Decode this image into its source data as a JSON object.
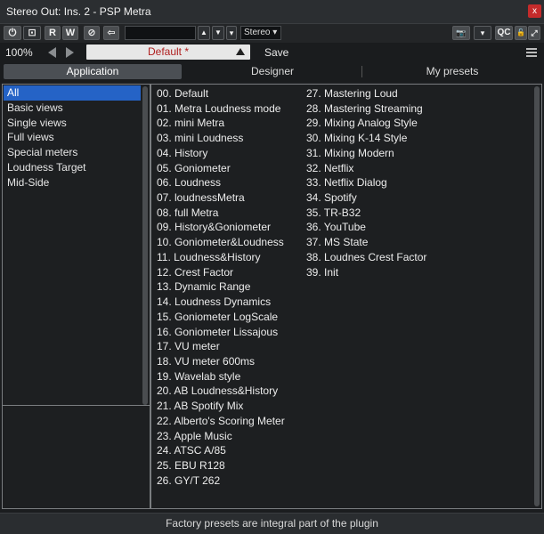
{
  "window": {
    "title": "Stereo Out: Ins. 2 - PSP Metra",
    "close_label": "x"
  },
  "hostbar": {
    "power_label": "⏻",
    "compare_label": "⊡",
    "read_label": "R",
    "write_label": "W",
    "bypass_label": "⊘",
    "back_label": "⇦",
    "preset_field": "",
    "routing_value": "Stereo",
    "routing_arrow": "▾",
    "up_label": "▲",
    "down_label": "▼",
    "more_label": "▾",
    "camera_label": "📷",
    "qc_label": "QC",
    "menu_label": "▾",
    "lock_label": "🔓",
    "expand_label": "⤢"
  },
  "header": {
    "zoom": "100%",
    "preset_name": "Default *",
    "save_label": "Save"
  },
  "tabs": [
    {
      "label": "Application"
    },
    {
      "label": "Designer"
    },
    {
      "label": "My presets"
    }
  ],
  "categories": [
    "All",
    "Basic views",
    "Single views",
    "Full views",
    "Special meters",
    "Loudness Target",
    "Mid-Side"
  ],
  "presets_col1": [
    "00. Default",
    "01. Metra Loudness mode",
    "02. mini Metra",
    "03. mini Loudness",
    "04. History",
    "05. Goniometer",
    "06. Loudness",
    "07. loudnessMetra",
    "08. full Metra",
    "09. History&Goniometer",
    "10. Goniometer&Loudness",
    "11. Loudness&History",
    "12. Crest Factor",
    "13. Dynamic Range",
    "14. Loudness Dynamics",
    "15. Goniometer LogScale",
    "16. Goniometer Lissajous",
    "17. VU meter",
    "18. VU meter 600ms",
    "19. Wavelab style",
    "20. AB Loudness&History",
    "21. AB Spotify Mix",
    "22. Alberto's Scoring Meter",
    "23. Apple Music",
    "24. ATSC A/85",
    "25. EBU R128",
    "26. GY/T 262"
  ],
  "presets_col2": [
    "27. Mastering Loud",
    "28. Mastering Streaming",
    "29. Mixing Analog Style",
    "30. Mixing K-14 Style",
    "31. Mixing Modern",
    "32. Netflix",
    "33. Netflix Dialog",
    "34. Spotify",
    "35. TR-B32",
    "36. YouTube",
    "37. MS State",
    "38. Loudnes Crest Factor",
    "39. Init"
  ],
  "footer": {
    "text": "Factory presets are integral part of the plugin"
  }
}
